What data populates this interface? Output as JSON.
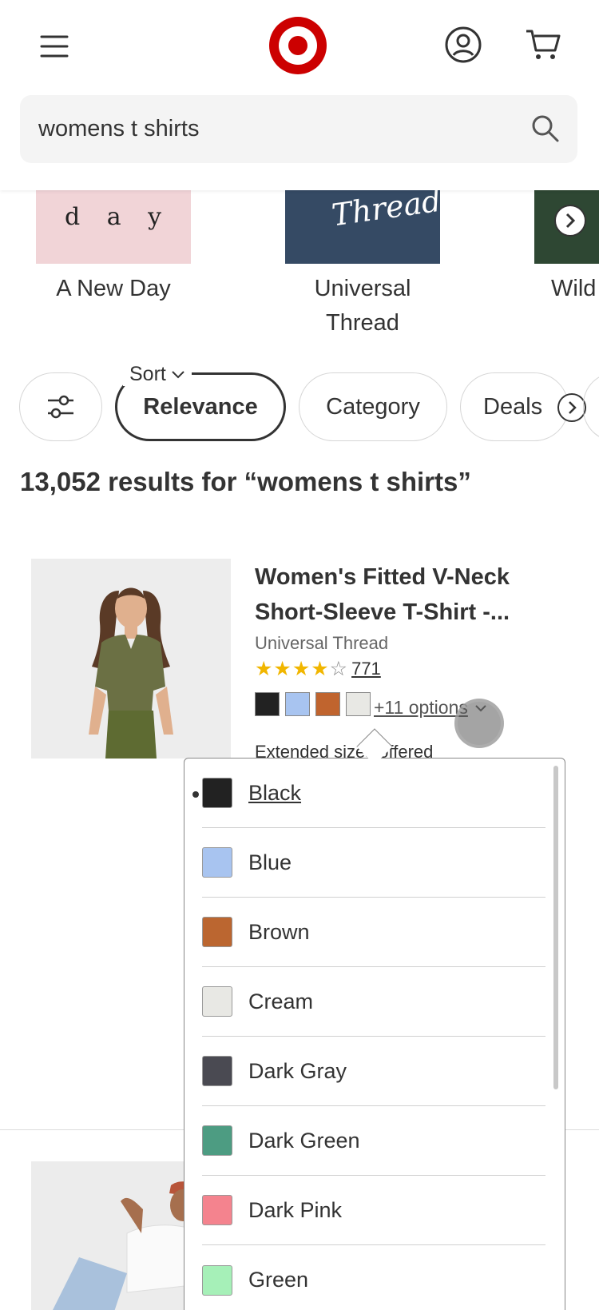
{
  "header": {
    "search": {
      "value": "womens t shirts",
      "placeholder": ""
    }
  },
  "brands": [
    {
      "label": "A New Day",
      "tile_text": "d a y"
    },
    {
      "label": "Universal Thread",
      "tile_text": "Thread"
    },
    {
      "label": "Wild",
      "tile_text": ""
    }
  ],
  "filters": {
    "sort_label": "Sort",
    "sort_value": "Relevance",
    "category": "Category",
    "deals": "Deals"
  },
  "results_text": "13,052 results for “womens t shirts”",
  "product": {
    "title": "Women's Fitted V-Neck Short-Sleeve T-Shirt -...",
    "brand": "Universal Thread",
    "stars": "★★★★",
    "star_empty": "☆",
    "rating_count": "771",
    "options_text": "+11 options",
    "extended_text": "Extended sizes offered",
    "swatches": [
      "#222222",
      "#a8c4f0",
      "#c0642e",
      "#e8e8e4"
    ]
  },
  "color_dropdown": {
    "options": [
      {
        "label": "Black",
        "color": "#222222",
        "selected": true
      },
      {
        "label": "Blue",
        "color": "#a8c4f0"
      },
      {
        "label": "Brown",
        "color": "#bb6630"
      },
      {
        "label": "Cream",
        "color": "#e8e8e4"
      },
      {
        "label": "Dark Gray",
        "color": "#4a4a52"
      },
      {
        "label": "Dark Green",
        "color": "#4d9c82"
      },
      {
        "label": "Dark Pink",
        "color": "#f4838e"
      },
      {
        "label": "Green",
        "color": "#a6f0b8"
      }
    ]
  },
  "colors": {
    "brand_red": "#cc0000",
    "text": "#333333"
  }
}
